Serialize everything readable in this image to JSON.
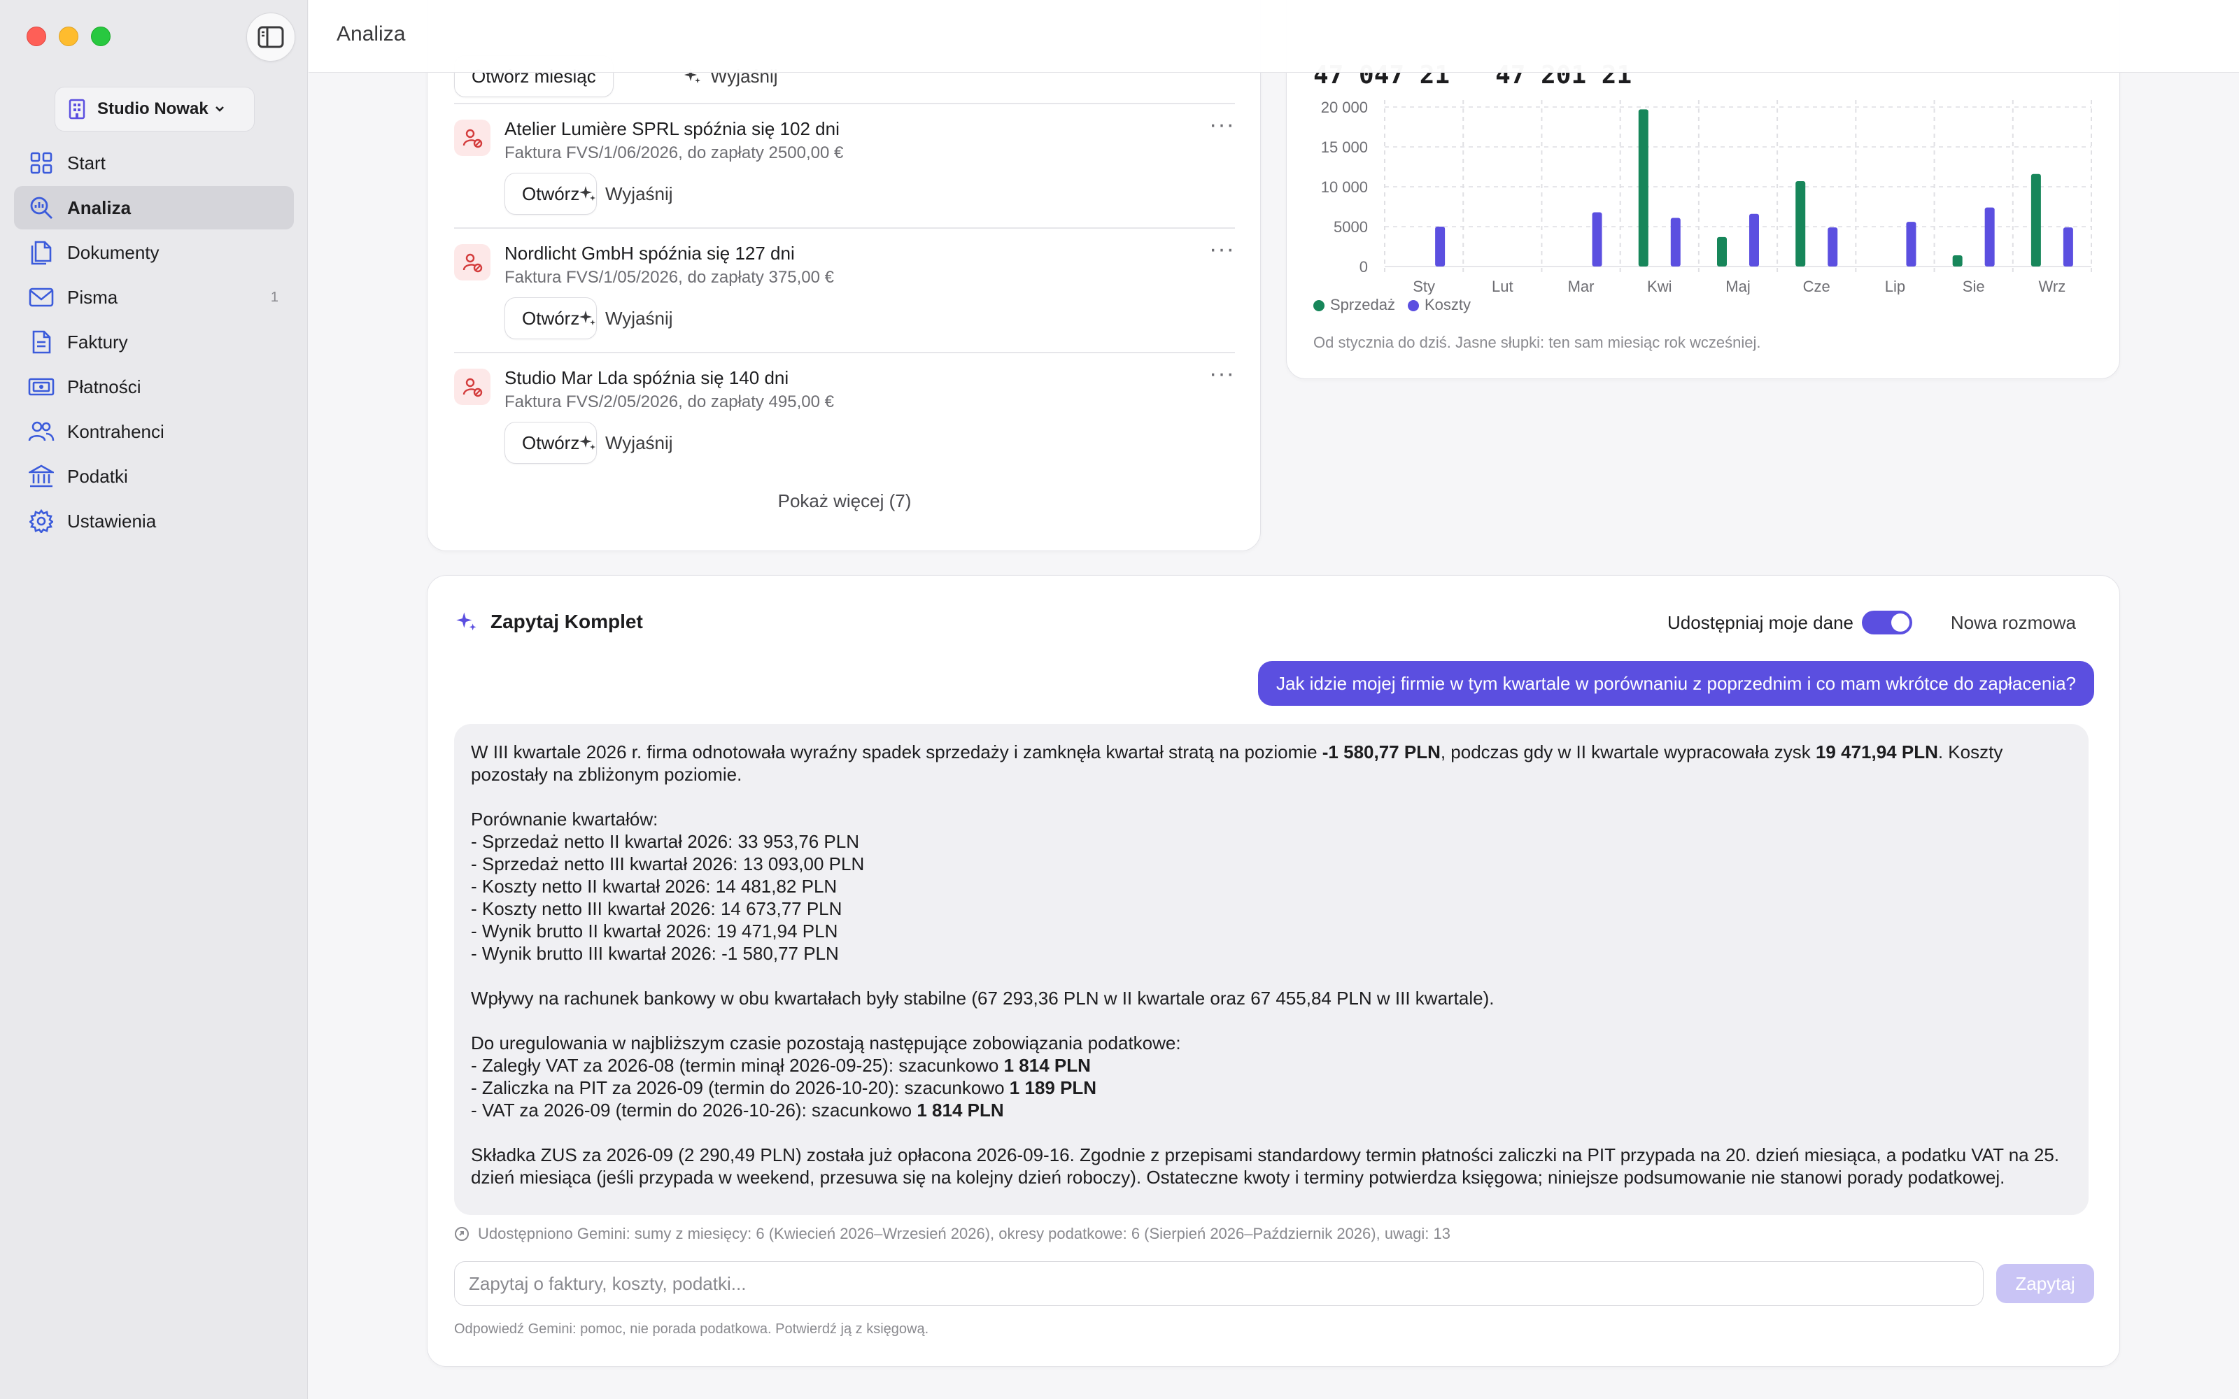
{
  "header": {
    "title": "Analiza"
  },
  "sidebar": {
    "workspace": "Studio Nowak",
    "items": [
      {
        "label": "Start",
        "icon": "grid-icon"
      },
      {
        "label": "Analiza",
        "icon": "magnifier-chart-icon",
        "active": true
      },
      {
        "label": "Dokumenty",
        "icon": "documents-icon"
      },
      {
        "label": "Pisma",
        "icon": "envelope-icon",
        "badge": "1"
      },
      {
        "label": "Faktury",
        "icon": "invoice-icon"
      },
      {
        "label": "Płatności",
        "icon": "banknote-icon"
      },
      {
        "label": "Kontrahenci",
        "icon": "people-icon"
      },
      {
        "label": "Podatki",
        "icon": "bank-icon"
      },
      {
        "label": "Ustawienia",
        "icon": "gear-icon"
      }
    ]
  },
  "overdue": {
    "partial_row": {
      "open_label": "Otwórz miesiąc",
      "explain_label": "Wyjaśnij"
    },
    "rows": [
      {
        "title": "Atelier Lumière SPRL spóźnia się 102 dni",
        "subtitle": "Faktura FVS/1/06/2026, do zapłaty 2500,00 €",
        "open_label": "Otwórz",
        "explain_label": "Wyjaśnij"
      },
      {
        "title": "Nordlicht GmbH spóźnia się 127 dni",
        "subtitle": "Faktura FVS/1/05/2026, do zapłaty 375,00 €",
        "open_label": "Otwórz",
        "explain_label": "Wyjaśnij"
      },
      {
        "title": "Studio Mar Lda spóźnia się 140 dni",
        "subtitle": "Faktura FVS/2/05/2026, do zapłaty 495,00 €",
        "open_label": "Otwórz",
        "explain_label": "Wyjaśnij"
      }
    ],
    "show_more": "Pokaż więcej (7)"
  },
  "chart": {
    "totals_text": "47 047 21   47 201 21",
    "legend": {
      "sales": "Sprzedaż",
      "costs": "Koszty"
    },
    "note": "Od stycznia do dziś. Jasne słupki: ten sam miesiąc rok wcześniej."
  },
  "chart_data": {
    "type": "bar",
    "categories": [
      "Sty",
      "Lut",
      "Mar",
      "Kwi",
      "Maj",
      "Cze",
      "Lip",
      "Sie",
      "Wrz"
    ],
    "series": [
      {
        "name": "Sprzedaż",
        "color": "#17865a",
        "values": [
          0,
          0,
          0,
          19700,
          3700,
          10700,
          0,
          1400,
          11600
        ]
      },
      {
        "name": "Koszty",
        "color": "#5b4fe0",
        "values": [
          5000,
          0,
          6800,
          6100,
          6600,
          4900,
          5600,
          7400,
          4900
        ]
      }
    ],
    "yticks": [
      "0",
      "5000",
      "10 000",
      "15 000",
      "20 000"
    ],
    "ylim": [
      0,
      20000
    ],
    "grid": true
  },
  "ask": {
    "title": "Zapytaj Komplet",
    "share_label": "Udostępniaj moje dane",
    "share_on": true,
    "new_conversation": "Nowa rozmowa",
    "user_message": "Jak idzie mojej firmie w tym kwartale w porównaniu z poprzednim i co mam wkrótce do zapłacenia?",
    "answer": {
      "p1_a": "W III kwartale 2026 r. firma odnotowała wyraźny spadek sprzedaży i zamknęła kwartał stratą na poziomie ",
      "p1_b": "-1 580,77 PLN",
      "p1_c": ", podczas gdy w II kwartale wypracowała zysk ",
      "p1_d": "19 471,94 PLN",
      "p1_e": ". Koszty pozostały na zbliżonym poziomie.",
      "compare_head": "Porównanie kwartałów:",
      "compare": [
        "- Sprzedaż netto II kwartał 2026: 33 953,76 PLN",
        "- Sprzedaż netto III kwartał 2026: 13 093,00 PLN",
        "- Koszty netto II kwartał 2026: 14 481,82 PLN",
        "- Koszty netto III kwartał 2026: 14 673,77 PLN",
        "- Wynik brutto II kwartał 2026: 19 471,94 PLN",
        "- Wynik brutto III kwartał 2026: -1 580,77 PLN"
      ],
      "inflows": "Wpływy na rachunek bankowy w obu kwartałach były stabilne (67 293,36 PLN w II kwartale oraz 67 455,84 PLN w III kwartale).",
      "due_head": "Do uregulowania w najbliższym czasie pozostają następujące zobowiązania podatkowe:",
      "due1_a": "- Zaległy VAT za 2026-08 (termin minął 2026-09-25): szacunkowo ",
      "due1_b": "1 814 PLN",
      "due2_a": "- Zaliczka na PIT za 2026-09 (termin do 2026-10-20): szacunkowo ",
      "due2_b": "1 189 PLN",
      "due3_a": "- VAT za 2026-09 (termin do 2026-10-26): szacunkowo ",
      "due3_b": "1 814 PLN",
      "zus": "Składka ZUS za 2026-09 (2 290,49 PLN) została już opłacona 2026-09-16. Zgodnie z przepisami standardowy termin płatności zaliczki na PIT przypada na 20. dzień miesiąca, a podatku VAT na 25. dzień miesiąca (jeśli przypada w weekend, przesuwa się na kolejny dzień roboczy). Ostateczne kwoty i terminy potwierdza księgowa; niniejsze podsumowanie nie stanowi porady podatkowej."
    },
    "shared_note": "Udostępniono Gemini: sumy z miesięcy: 6 (Kwiecień 2026–Wrzesień 2026), okresy podatkowe: 6 (Sierpień 2026–Październik 2026), uwagi: 13",
    "input_placeholder": "Zapytaj o faktury, koszty, podatki...",
    "submit_label": "Zapytaj",
    "disclaimer": "Odpowiedź Gemini: pomoc, nie porada podatkowa. Potwierdź ją z księgową."
  },
  "colors": {
    "accent": "#5b4fe0",
    "sales": "#17865a",
    "danger": "#d33b3b"
  }
}
